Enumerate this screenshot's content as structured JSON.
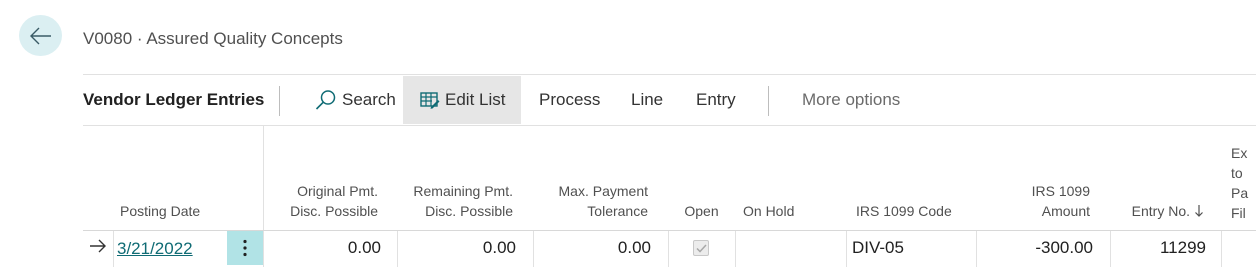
{
  "header": {
    "caption": "V0080 · Assured Quality Concepts"
  },
  "part": {
    "title": "Vendor Ledger Entries"
  },
  "actions": {
    "search": "Search",
    "edit_list": "Edit List",
    "process": "Process",
    "line": "Line",
    "entry": "Entry",
    "more_options": "More options"
  },
  "columns": {
    "posting_date": "Posting Date",
    "orig_pmt_disc": "Original Pmt.\nDisc. Possible",
    "rem_pmt_disc": "Remaining Pmt.\nDisc. Possible",
    "max_payment_tol": "Max. Payment\nTolerance",
    "open": "Open",
    "on_hold": "On Hold",
    "irs_1099_code": "IRS 1099 Code",
    "irs_1099_amount": "IRS 1099\nAmount",
    "entry_no": "Entry No.",
    "truncated": "Ex\nto\nPa\nFil"
  },
  "rows": [
    {
      "posting_date": "3/21/2022",
      "orig_pmt_disc": "0.00",
      "rem_pmt_disc": "0.00",
      "max_payment_tol": "0.00",
      "open": true,
      "on_hold": "",
      "irs_1099_code": "DIV-05",
      "irs_1099_amount": "-300.00",
      "entry_no": "11299"
    }
  ],
  "colors": {
    "accent": "#0f6b74",
    "back_button_bg": "#dbeff2",
    "row_menu_bg": "#b1e3e6",
    "active_action_bg": "#e6e6e6"
  },
  "icons": {
    "back": "arrow-left-icon",
    "search": "search-icon",
    "edit_list": "edit-list-icon",
    "row_current": "arrow-right-icon",
    "row_menu": "more-vertical-icon",
    "sort": "sort-descending-icon"
  }
}
